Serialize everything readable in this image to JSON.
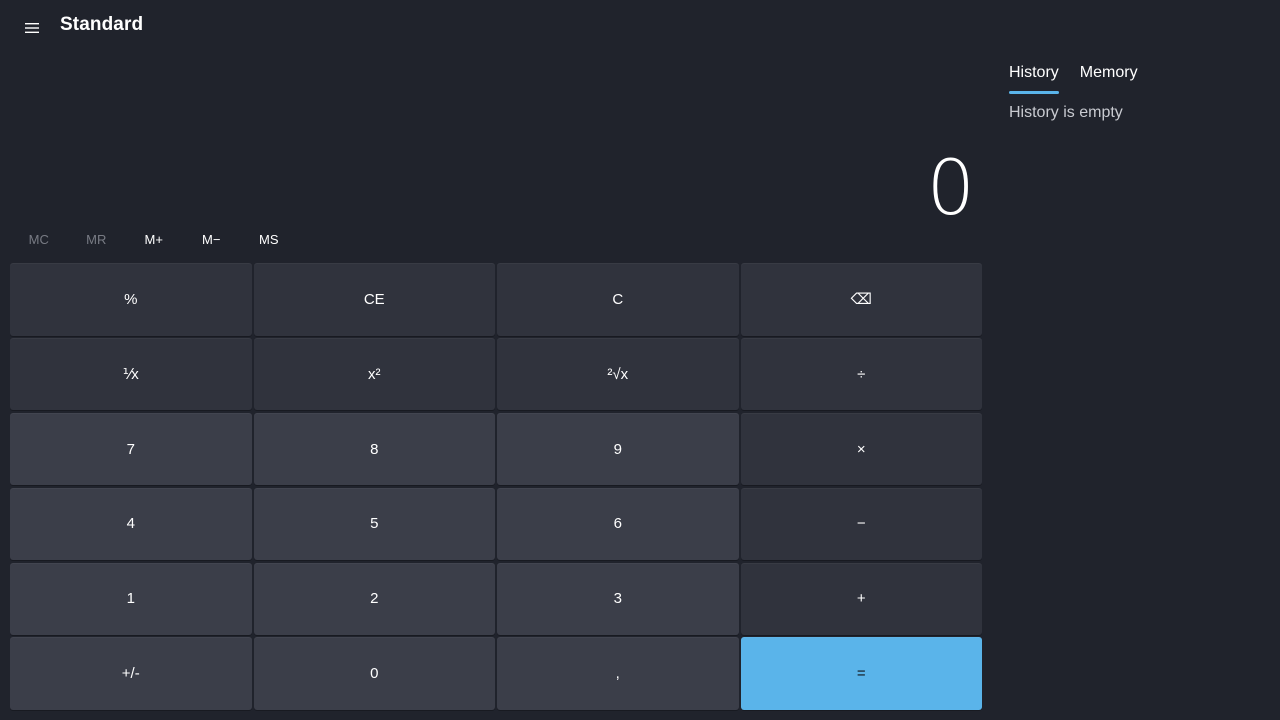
{
  "header": {
    "menu_icon": "hamburger-menu-icon",
    "title": "Standard"
  },
  "display": {
    "value": "0"
  },
  "memory": {
    "buttons": [
      {
        "label": "MC",
        "enabled": false
      },
      {
        "label": "MR",
        "enabled": false
      },
      {
        "label": "M+",
        "enabled": true
      },
      {
        "label": "M−",
        "enabled": true
      },
      {
        "label": "MS",
        "enabled": true
      }
    ]
  },
  "keypad": {
    "keys": [
      {
        "label": "%",
        "kind": "op",
        "name": "percent"
      },
      {
        "label": "CE",
        "kind": "op",
        "name": "clear-entry"
      },
      {
        "label": "C",
        "kind": "op",
        "name": "clear"
      },
      {
        "label": "⌫",
        "kind": "op",
        "name": "backspace"
      },
      {
        "label": "⅟x",
        "kind": "op",
        "name": "reciprocal"
      },
      {
        "label": "x²",
        "kind": "op",
        "name": "square"
      },
      {
        "label": "²√x",
        "kind": "op",
        "name": "square-root"
      },
      {
        "label": "÷",
        "kind": "op",
        "name": "divide"
      },
      {
        "label": "7",
        "kind": "num",
        "name": "digit-7"
      },
      {
        "label": "8",
        "kind": "num",
        "name": "digit-8"
      },
      {
        "label": "9",
        "kind": "num",
        "name": "digit-9"
      },
      {
        "label": "×",
        "kind": "op",
        "name": "multiply"
      },
      {
        "label": "4",
        "kind": "num",
        "name": "digit-4"
      },
      {
        "label": "5",
        "kind": "num",
        "name": "digit-5"
      },
      {
        "label": "6",
        "kind": "num",
        "name": "digit-6"
      },
      {
        "label": "−",
        "kind": "op",
        "name": "subtract"
      },
      {
        "label": "1",
        "kind": "num",
        "name": "digit-1"
      },
      {
        "label": "2",
        "kind": "num",
        "name": "digit-2"
      },
      {
        "label": "3",
        "kind": "num",
        "name": "digit-3"
      },
      {
        "label": "+",
        "kind": "op",
        "name": "add"
      },
      {
        "label": "+/-",
        "kind": "num",
        "name": "negate"
      },
      {
        "label": "0",
        "kind": "num",
        "name": "digit-0"
      },
      {
        "label": ",",
        "kind": "num",
        "name": "decimal"
      },
      {
        "label": "=",
        "kind": "equals",
        "name": "equals"
      }
    ]
  },
  "side_panel": {
    "tabs": [
      {
        "label": "History",
        "active": true
      },
      {
        "label": "Memory",
        "active": false
      }
    ],
    "empty_message": "History is empty"
  },
  "colors": {
    "background": "#20232c",
    "key": "#393c47",
    "accent": "#5ab4ea"
  }
}
